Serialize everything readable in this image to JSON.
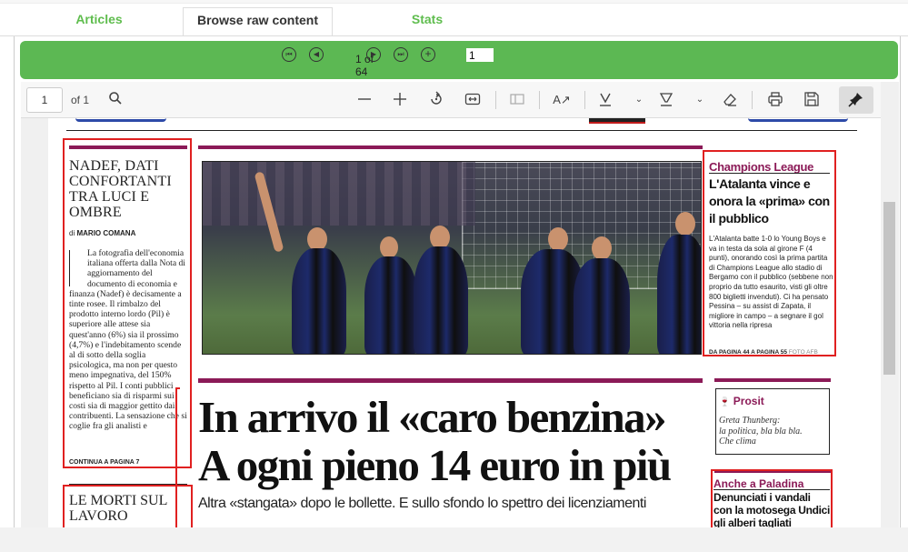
{
  "tabs": [
    {
      "label": "Articles"
    },
    {
      "label": "Browse raw content"
    },
    {
      "label": "Stats"
    }
  ],
  "nav": {
    "page_counter_line1": "1 of",
    "page_counter_line2": "64",
    "page_input_value": "1",
    "icons": [
      "first-page-icon",
      "prev-page-icon",
      "next-page-icon",
      "last-page-icon",
      "add-icon"
    ]
  },
  "viewer": {
    "page_number": "1",
    "page_total": "of 1",
    "tool_icons": [
      "search-icon",
      "zoom-out-icon",
      "zoom-in-icon",
      "rotate-icon",
      "fit-width-icon",
      "thumbnails-icon",
      "text-tool-icon",
      "highlight-icon",
      "draw-icon",
      "eraser-icon",
      "print-icon",
      "save-icon",
      "pin-icon"
    ]
  },
  "newspaper": {
    "nadef": {
      "title": "NADEF, DATI CONFORTANTI TRA LUCI E OMBRE",
      "byline_prefix": "di",
      "byline_name": "MARIO COMANA",
      "body": "La fotografia dell'economia italiana offerta dalla Nota di aggiornamento del documento di economia e finanza (Nadef) è decisamente a tinte rosee. Il rimbalzo del prodotto interno lordo (Pil) è superiore alle attese sia quest'anno (6%) sia il prossimo (4,7%) e l'indebitamento scende al di sotto della soglia psicologica, ma non per questo meno impegnativa, del 150% rispetto al Pil. I conti pubblici beneficiano sia di risparmi sui costi sia di maggior gettito dai contribuenti. La sensazione che si coglie fra gli analisti e",
      "continue": "CONTINUA A PAGINA 7"
    },
    "morti": {
      "title": "LE MORTI SUL LAVORO"
    },
    "champions": {
      "section": "Champions League",
      "headline": "L'Atalanta vince e onora la «prima» con il pubblico",
      "body": "L'Atalanta batte 1-0 lo Young Boys e va in testa da sola al girone F (4 punti), onorando così la prima partita di Champions League allo stadio di Bergamo con il pubblico (sebbene non proprio da tutto esaurito, visti gli oltre 800 biglietti invenduti). Ci ha pensato Pessina – su assist di Zapata, il migliore in campo – a segnare il gol vittoria nella ripresa",
      "ref": "DA PAGINA 44 A PAGINA 55",
      "credit": "FOTO AFB"
    },
    "main": {
      "headline_line1": "In arrivo il «caro benzina»",
      "headline_line2": "A ogni pieno 14 euro in più",
      "subhead": "Altra «stangata» dopo le bollette. E sullo sfondo lo spettro dei licenziamenti"
    },
    "prosit": {
      "title": "Prosit",
      "quote_line1": "Greta Thunberg:",
      "quote_line2": "la politica, bla bla bla.",
      "quote_line3": "Che clima"
    },
    "paladina": {
      "section": "Anche a Paladina",
      "headline": "Denunciati i vandali con la motosega Undici gli alberi tagliati"
    }
  },
  "colors": {
    "green_bar": "#5cb853",
    "tab_link": "#5fbd4e",
    "maroon": "#8b1a57",
    "highlight_box": "#e02020"
  }
}
